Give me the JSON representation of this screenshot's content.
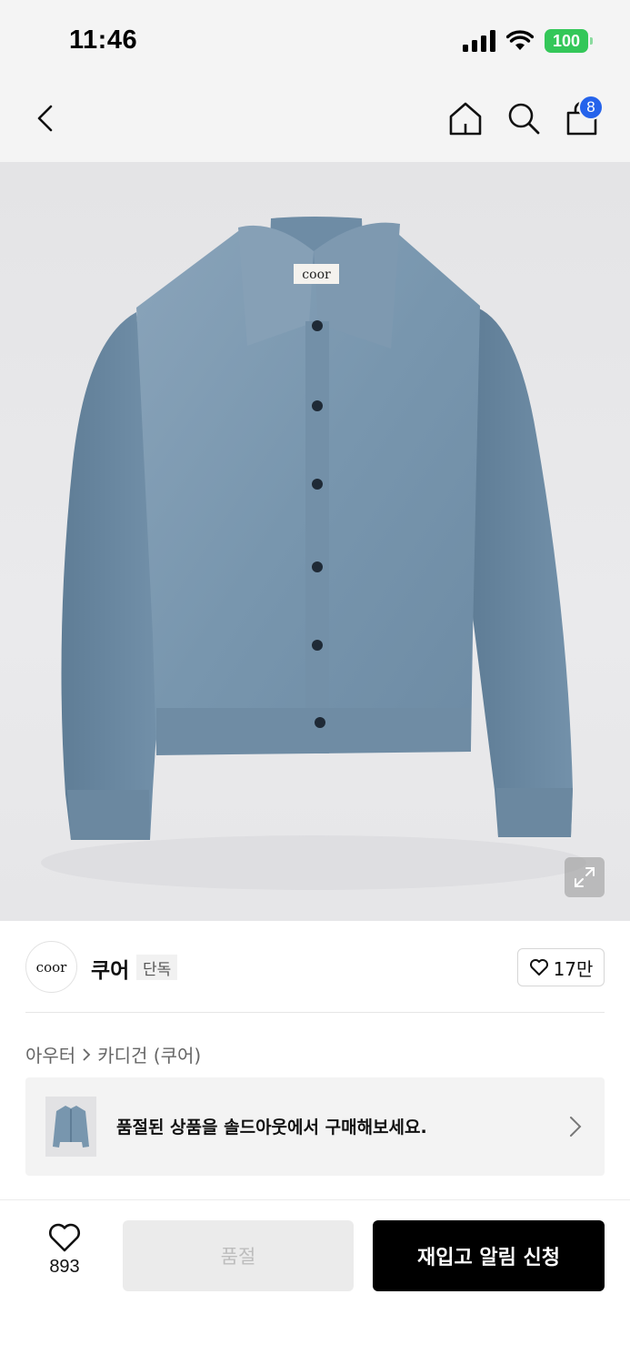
{
  "status_bar": {
    "time": "11:46",
    "battery": "100",
    "icons": [
      "signal-icon",
      "wifi-icon",
      "battery-icon"
    ],
    "battery_color": "#34c759"
  },
  "nav": {
    "icons": [
      "back-icon",
      "home-icon",
      "search-icon",
      "cart-icon"
    ],
    "cart_count": "8",
    "badge_color": "#2563eb"
  },
  "product_image": {
    "label_text": "coor",
    "garment_color": "#7896ae",
    "expand_icon": "expand-icon"
  },
  "brand": {
    "logo_text": "coor",
    "name": "쿠어",
    "tag": "단독",
    "likes": "17만"
  },
  "breadcrumb": {
    "category": "아우터",
    "subcategory": "카디건 (쿠어)"
  },
  "soldout_banner": {
    "message": "품절된 상품을 솔드아웃에서 구매해보세요."
  },
  "bottom_bar": {
    "wish_count": "893",
    "soldout_label": "품절",
    "restock_label": "재입고 알림 신청"
  }
}
